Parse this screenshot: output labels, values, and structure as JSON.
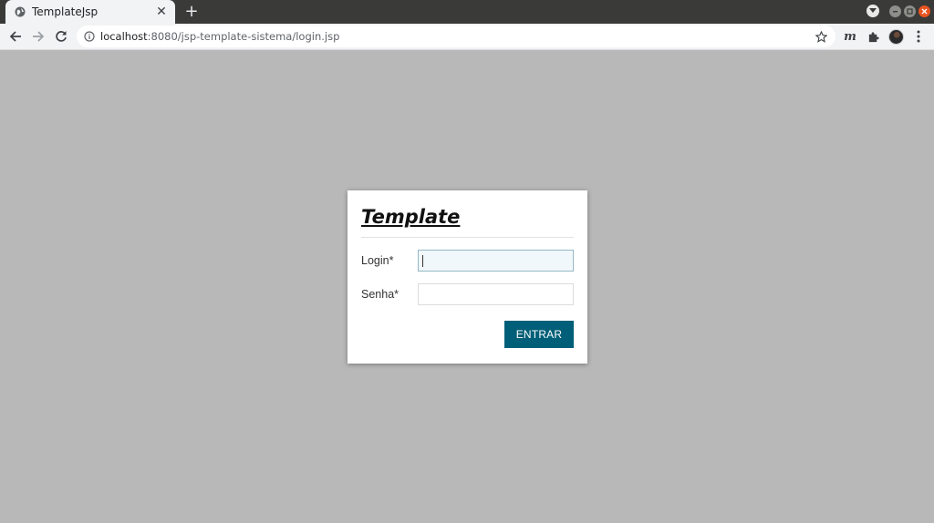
{
  "browser": {
    "tab_title": "TemplateJsp",
    "tab_close": "✕",
    "new_tab": "+",
    "url_host": "localhost",
    "url_path": ":8080/jsp-template-sistema/login.jsp"
  },
  "login": {
    "title": "Template",
    "login_label": "Login*",
    "login_value": "",
    "senha_label": "Senha*",
    "senha_value": "",
    "submit_label": "ENTRAR"
  },
  "colors": {
    "page_bg": "#b8b8b8",
    "button_bg": "#005f78"
  },
  "icons": [
    "globe-icon",
    "close-icon",
    "plus-icon",
    "back-arrow-icon",
    "forward-arrow-icon",
    "reload-icon",
    "info-icon",
    "star-icon",
    "extension-m-icon",
    "puzzle-icon",
    "avatar",
    "kebab-menu-icon",
    "dropdown-icon",
    "minimize-icon",
    "maximize-icon",
    "close-window-icon"
  ]
}
